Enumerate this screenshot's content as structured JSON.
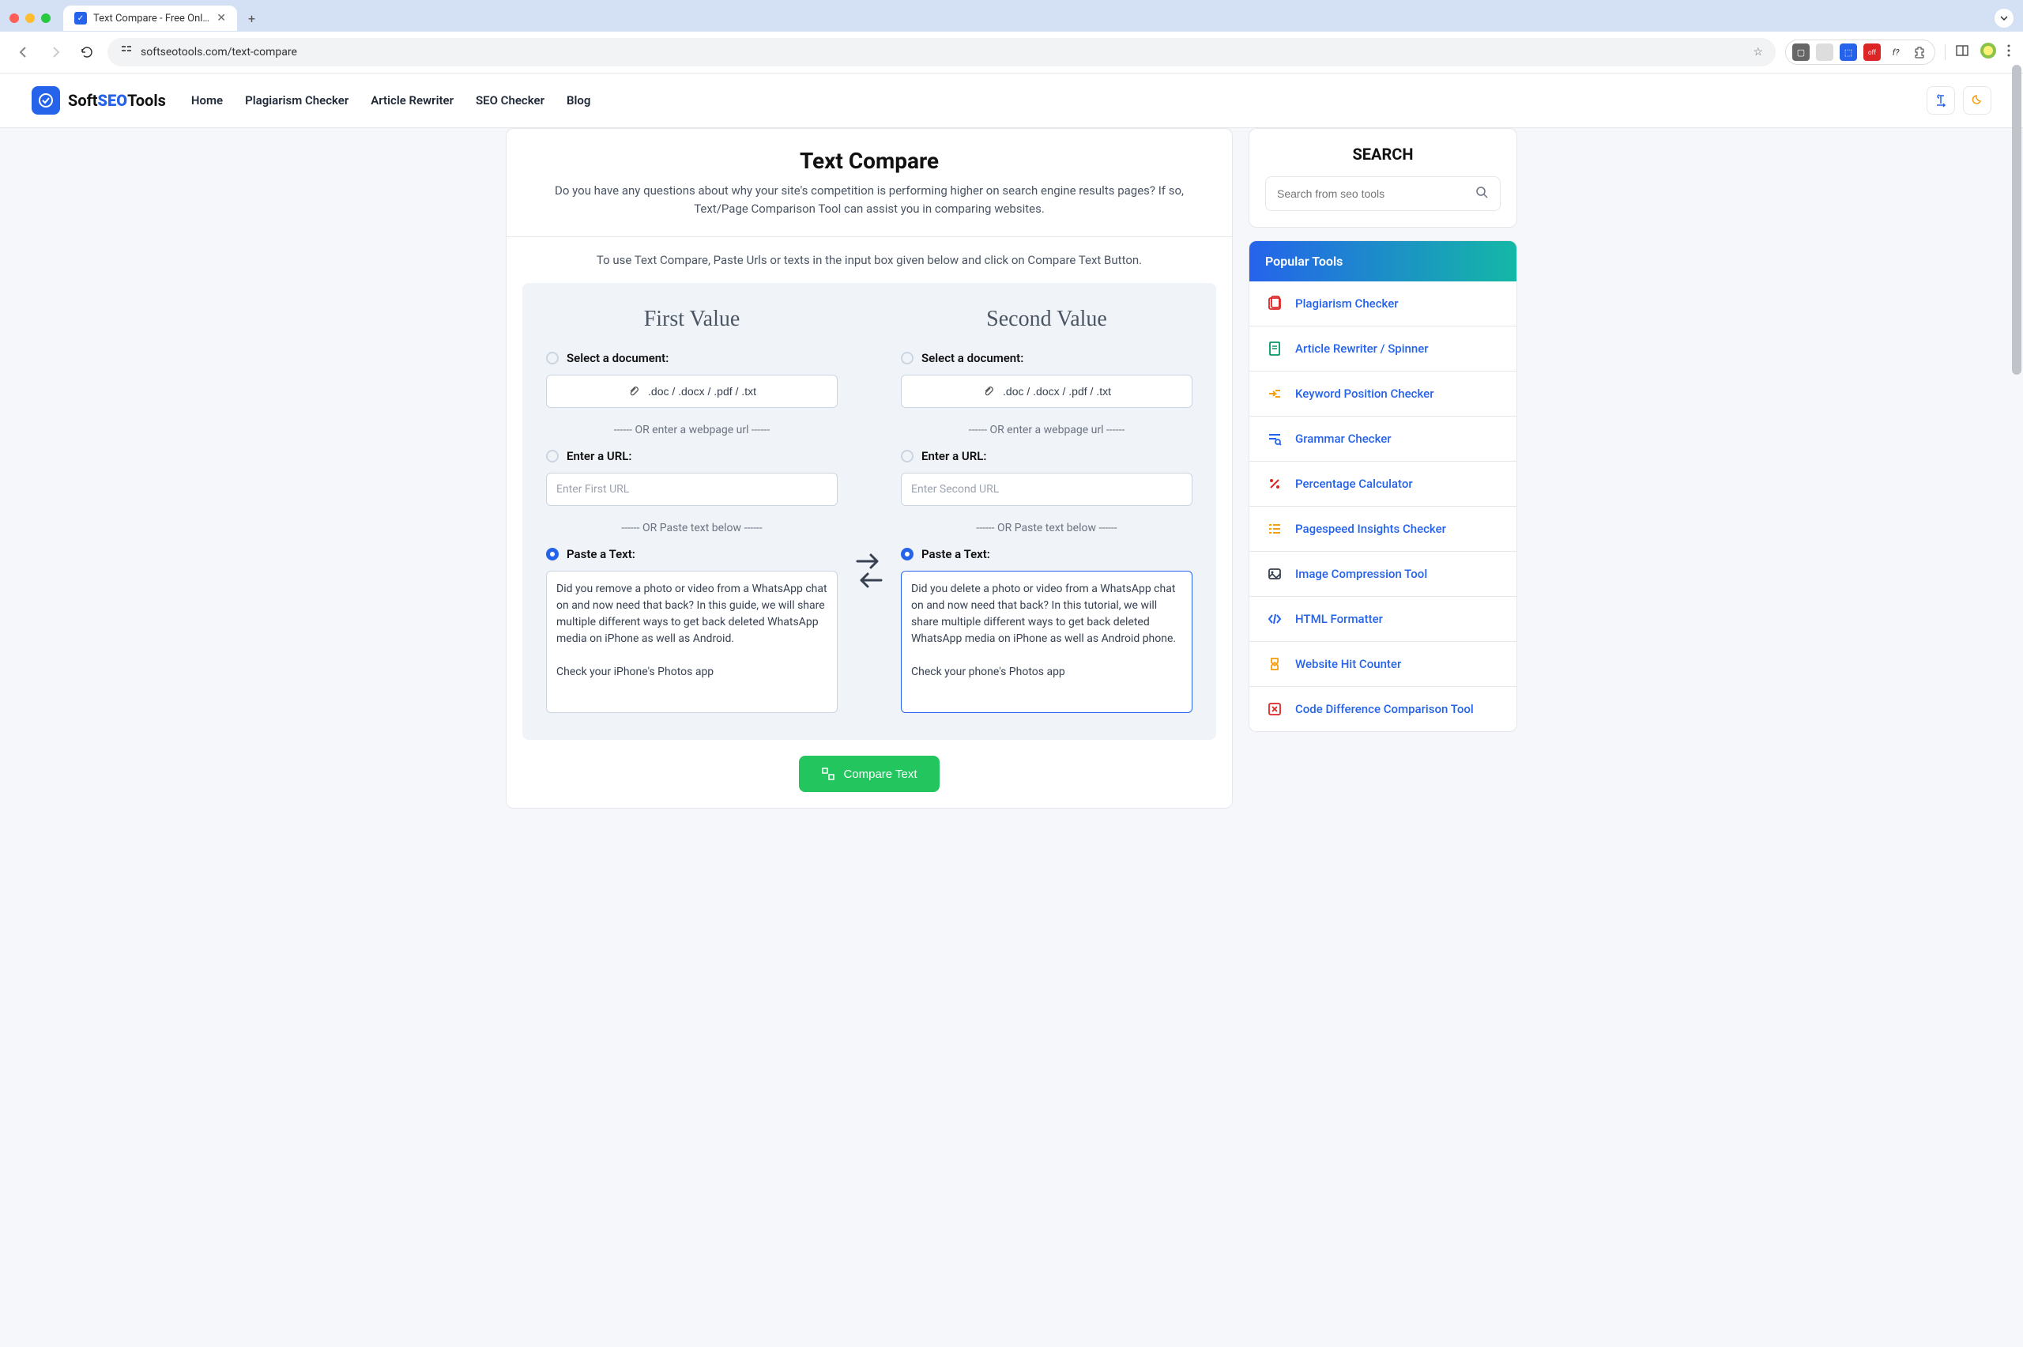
{
  "browser": {
    "tab_title": "Text Compare - Free Online T",
    "url": "softseotools.com/text-compare"
  },
  "nav": {
    "brand_prefix": "Soft",
    "brand_bold": "SEO",
    "brand_suffix": "Tools",
    "links": [
      "Home",
      "Plagiarism Checker",
      "Article Rewriter",
      "SEO Checker",
      "Blog"
    ]
  },
  "page": {
    "title": "Text Compare",
    "description": "Do you have any questions about why your site's competition is performing higher on search engine results pages? If so, Text/Page Comparison Tool can assist you in comparing websites.",
    "instruction": "To use Text Compare, Paste Urls or texts in the input box given below and click on Compare Text Button."
  },
  "compare": {
    "col1_title": "First Value",
    "col2_title": "Second Value",
    "select_doc": "Select a document:",
    "file_types": ".doc / .docx / .pdf / .txt",
    "or_url": "------ OR enter a webpage url ------",
    "enter_url": "Enter a URL:",
    "url1_placeholder": "Enter First URL",
    "url2_placeholder": "Enter Second URL",
    "or_paste": "------ OR Paste text below ------",
    "paste_text": "Paste a Text:",
    "text1": "Did you remove a photo or video from a WhatsApp chat on and now need that back? In this guide, we will share multiple different ways to get back deleted WhatsApp media on iPhone as well as Android.\n\nCheck your iPhone's Photos app",
    "text2": "Did you delete a photo or video from a WhatsApp chat on and now need that back? In this tutorial, we will share multiple different ways to get back deleted WhatsApp media on iPhone as well as Android phone.\n\nCheck your phone's Photos app",
    "button": "Compare Text"
  },
  "sidebar": {
    "search_title": "SEARCH",
    "search_placeholder": "Search from seo tools",
    "popular_title": "Popular Tools",
    "tools": [
      {
        "label": "Plagiarism Checker",
        "color": "#dc2626"
      },
      {
        "label": "Article Rewriter / Spinner",
        "color": "#059669"
      },
      {
        "label": "Keyword Position Checker",
        "color": "#f59e0b"
      },
      {
        "label": "Grammar Checker",
        "color": "#2563eb"
      },
      {
        "label": "Percentage Calculator",
        "color": "#dc2626"
      },
      {
        "label": "Pagespeed Insights Checker",
        "color": "#f59e0b"
      },
      {
        "label": "Image Compression Tool",
        "color": "#374151"
      },
      {
        "label": "HTML Formatter",
        "color": "#2563eb"
      },
      {
        "label": "Website Hit Counter",
        "color": "#f59e0b"
      },
      {
        "label": "Code Difference Comparison Tool",
        "color": "#dc2626"
      }
    ]
  }
}
